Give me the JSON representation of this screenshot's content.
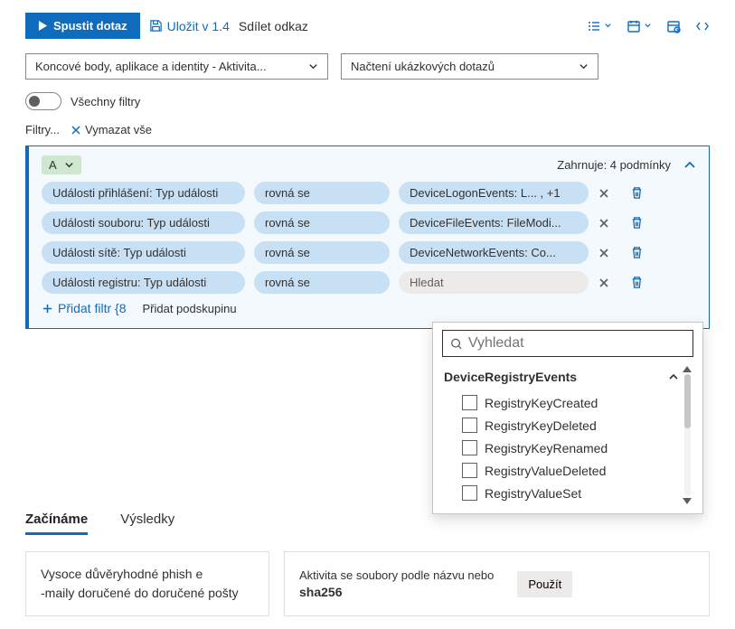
{
  "toolbar": {
    "run": "Spustit dotaz",
    "save": "Uložit v 1.4",
    "share": "Sdílet odkaz"
  },
  "dropdowns": {
    "scope": "Koncové body, aplikace a identity - Aktivita...",
    "samples": "Načtení ukázkových dotazů"
  },
  "toggle_label": "Všechny filtry",
  "filters_label": "Filtry...",
  "clear_all": "Vymazat vše",
  "group": {
    "name": "A",
    "summary": "Zahrnuje: 4 podmínky",
    "rows": [
      {
        "field": "Události přihlášení: Typ události",
        "op": "rovná se",
        "value": "DeviceLogonEvents: L... , +1",
        "search": false
      },
      {
        "field": "Události souboru: Typ události",
        "op": "rovná se",
        "value": "DeviceFileEvents: FileModi...",
        "search": false
      },
      {
        "field": "Události sítě: Typ události",
        "op": "rovná se",
        "value": "DeviceNetworkEvents: Co...",
        "search": false
      },
      {
        "field": "Události registru: Typ události",
        "op": "rovná se",
        "value": "Hledat",
        "search": true
      }
    ],
    "add_filter": "Přidat filtr {8",
    "add_subgroup": "Přidat podskupinu"
  },
  "popup": {
    "placeholder": "Vyhledat",
    "group": "DeviceRegistryEvents",
    "items": [
      "RegistryKeyCreated",
      "RegistryKeyDeleted",
      "RegistryKeyRenamed",
      "RegistryValueDeleted",
      "RegistryValueSet"
    ]
  },
  "tabs": {
    "start": "Začínáme",
    "results": "Výsledky"
  },
  "cards": {
    "left_l1": "Vysoce důvěryhodné phish e",
    "left_l2": "-maily doručené do doručené pošty",
    "right_title": "Aktivita se soubory podle názvu nebo",
    "right_bold": "sha256",
    "apply": "Použít"
  }
}
